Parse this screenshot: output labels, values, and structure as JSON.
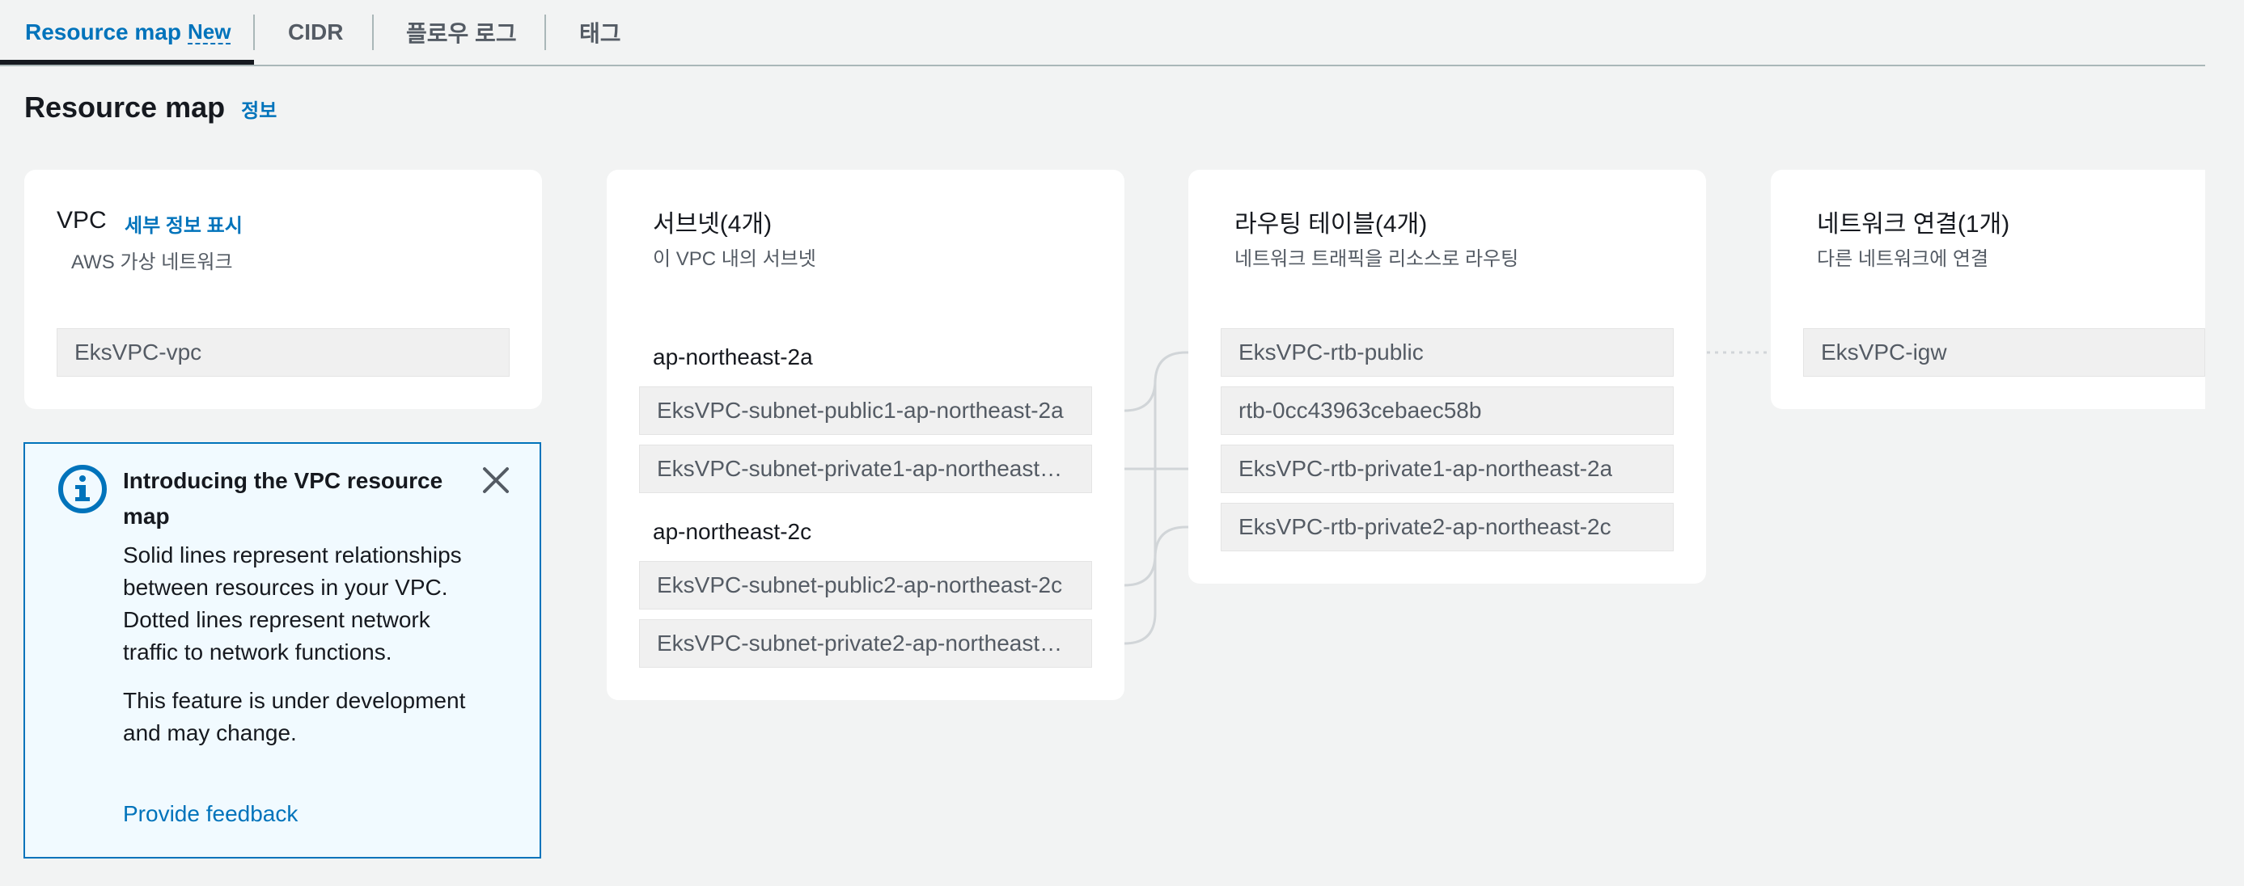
{
  "tabs": {
    "resource_map": "Resource map",
    "new_badge": "New",
    "cidr": "CIDR",
    "flow_logs": "플로우 로그",
    "tags": "태그"
  },
  "heading": {
    "title": "Resource map",
    "info": "정보"
  },
  "vpc": {
    "title": "VPC",
    "details_link": "세부 정보 표시",
    "subtitle": "AWS 가상 네트워크",
    "item": "EksVPC-vpc"
  },
  "subnets": {
    "title": "서브넷(4개)",
    "subtitle": "이 VPC 내의 서브넷",
    "az1": "ap-northeast-2a",
    "az2": "ap-northeast-2c",
    "items": [
      "EksVPC-subnet-public1-ap-northeast-2a",
      "EksVPC-subnet-private1-ap-northeast…",
      "EksVPC-subnet-public2-ap-northeast-2c",
      "EksVPC-subnet-private2-ap-northeast…"
    ]
  },
  "route_tables": {
    "title": "라우팅 테이블(4개)",
    "subtitle": "네트워크 트래픽을 리소스로 라우팅",
    "items": [
      "EksVPC-rtb-public",
      "rtb-0cc43963cebaec58b",
      "EksVPC-rtb-private1-ap-northeast-2a",
      "EksVPC-rtb-private2-ap-northeast-2c"
    ]
  },
  "network_connections": {
    "title": "네트워크 연결(1개)",
    "subtitle": "다른 네트워크에 연결",
    "items": [
      "EksVPC-igw"
    ]
  },
  "info_panel": {
    "title": "Introducing the VPC resource map",
    "paragraph1": "Solid lines represent relationships between resources in your VPC. Dotted lines represent network traffic to network functions.",
    "paragraph2": "This feature is under development and may change.",
    "feedback": "Provide feedback"
  },
  "icons": {
    "info": "info-circle-icon",
    "close": "close-icon"
  },
  "colors": {
    "accent": "#0073bb",
    "background": "#f2f3f3",
    "panel": "#f1faff"
  }
}
